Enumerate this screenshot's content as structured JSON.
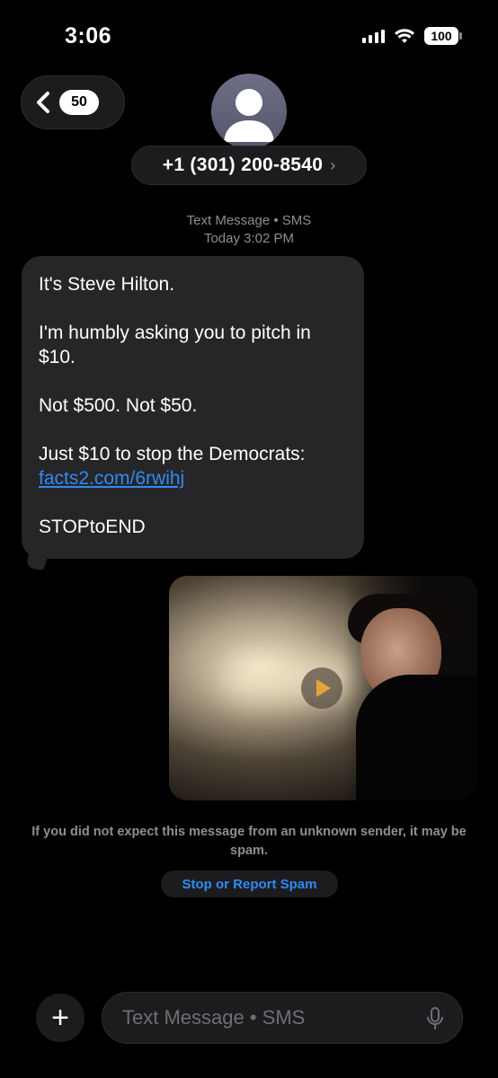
{
  "status_bar": {
    "time": "3:06",
    "battery": "100"
  },
  "header": {
    "back_badge_count": "50",
    "contact_number": "+1 (301) 200-8540",
    "contact_chevron": "›"
  },
  "thread": {
    "service_label": "Text Message • SMS",
    "timestamp": "Today 3:02 PM"
  },
  "message": {
    "paragraphs": [
      "It's Steve Hilton.",
      "I'm humbly asking you to pitch in $10.",
      "Not $500. Not $50."
    ],
    "closing_text": "Just $10 to stop the Democrats: ",
    "link_text": "facts2.com/6rwihj",
    "footer": "STOPtoEND"
  },
  "media": {
    "type": "video",
    "icon": "play-icon"
  },
  "spam_warning": {
    "text": "If you did not expect this message from an unknown sender, it may be spam.",
    "button_label": "Stop or Report Spam"
  },
  "composer": {
    "plus_label": "+",
    "placeholder": "Text Message • SMS"
  },
  "colors": {
    "background": "#000000",
    "bubble": "#262628",
    "link": "#2f8af5",
    "secondary_text": "#8e8e93"
  }
}
